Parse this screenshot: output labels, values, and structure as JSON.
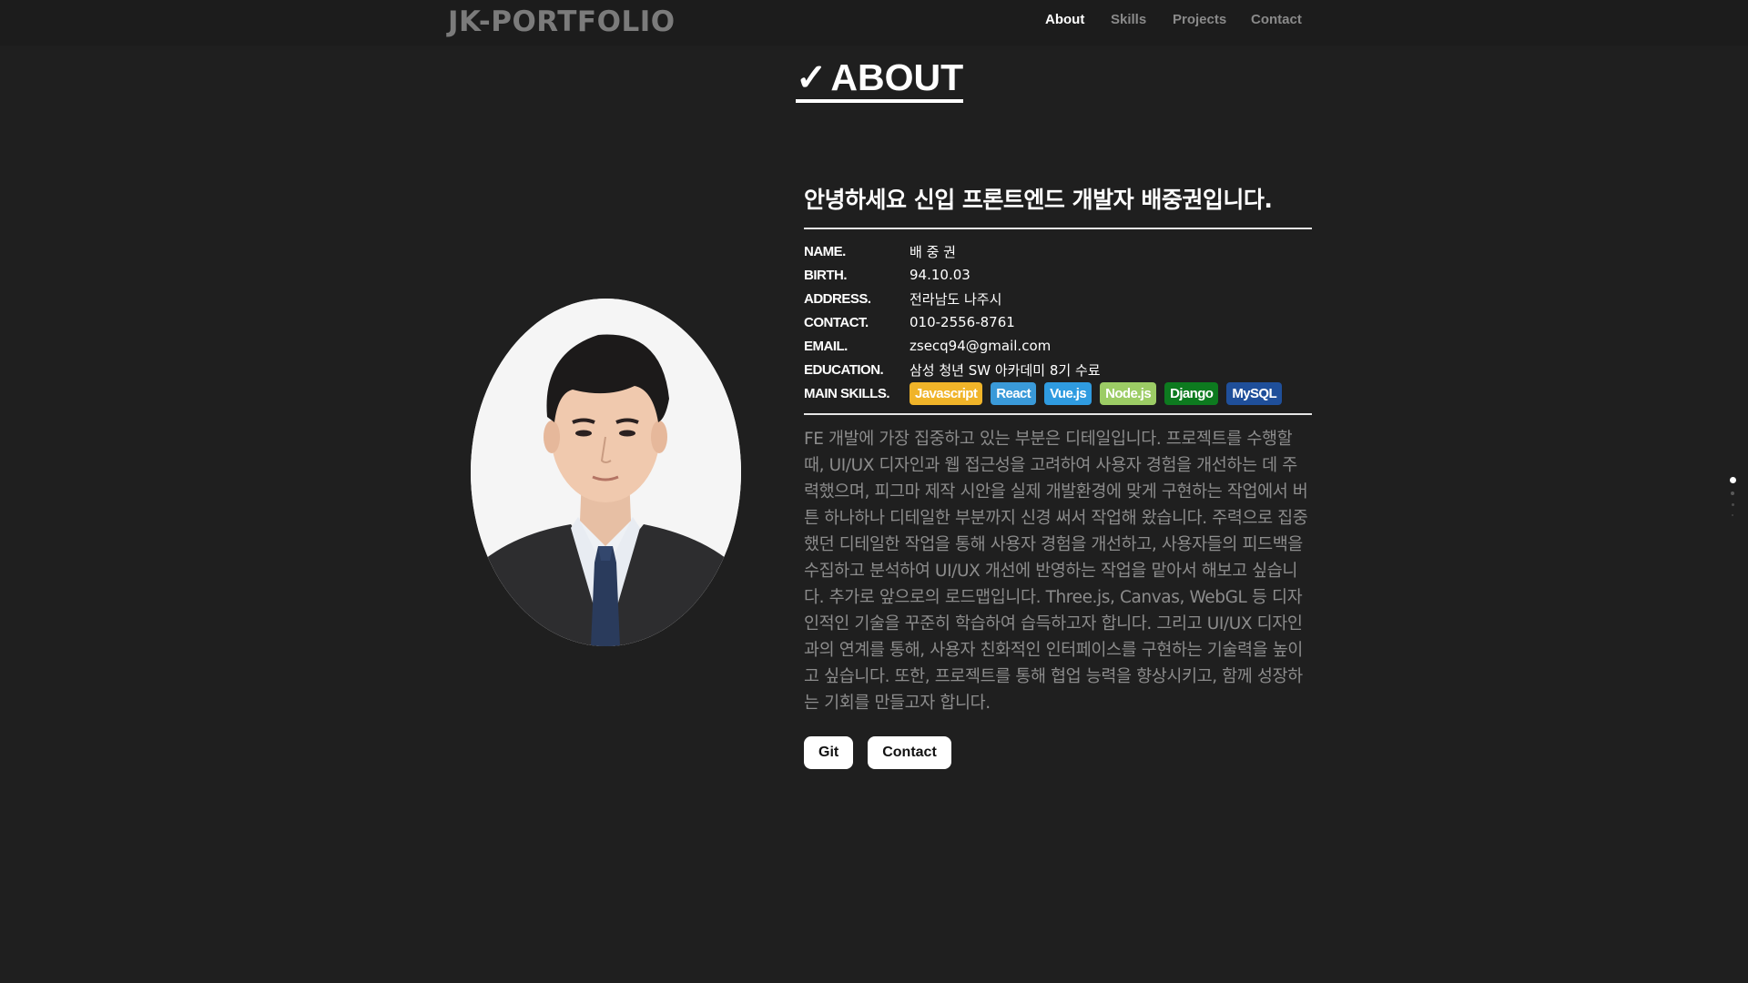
{
  "header": {
    "logo": "JK-PORTFOLIO",
    "nav": [
      {
        "label": "About",
        "active": true
      },
      {
        "label": "Skills",
        "active": false
      },
      {
        "label": "Projects",
        "active": false
      },
      {
        "label": "Contact",
        "active": false
      }
    ]
  },
  "section": {
    "check": "✓",
    "title": "ABOUT"
  },
  "profile": {
    "headline": "안녕하세요 신입 프론트엔드 개발자 배중권입니다.",
    "fields": [
      {
        "key": "NAME.",
        "value": "배 중 권"
      },
      {
        "key": "BIRTH.",
        "value": "94.10.03"
      },
      {
        "key": "ADDRESS.",
        "value": "전라남도 나주시"
      },
      {
        "key": "CONTACT.",
        "value": "010-2556-8761"
      },
      {
        "key": "EMAIL.",
        "value": "zsecq94@gmail.com"
      },
      {
        "key": "EDUCATION.",
        "value": "삼성 청년 SW 아카데미 8기 수료"
      }
    ],
    "skills_label": "MAIN SKILLS.",
    "skills": [
      {
        "name": "Javascript",
        "color": "#f0b429"
      },
      {
        "name": "React",
        "color": "#3a9ad9"
      },
      {
        "name": "Vue.js",
        "color": "#2f9be0"
      },
      {
        "name": "Node.js",
        "color": "#9ccc65"
      },
      {
        "name": "Django",
        "color": "#0d7a1f"
      },
      {
        "name": "MySQL",
        "color": "#1f4f9a"
      }
    ],
    "description": "FE 개발에 가장 집중하고 있는 부분은 디테일입니다. 프로젝트를 수행할 때, UI/UX 디자인과 웹 접근성을 고려하여 사용자 경험을 개선하는 데 주력했으며, 피그마 제작 시안을 실제 개발환경에 맞게 구현하는 작업에서 버튼 하나하나 디테일한 부분까지 신경 써서 작업해 왔습니다. 주력으로 집중했던 디테일한 작업을 통해 사용자 경험을 개선하고, 사용자들의 피드백을 수집하고 분석하여 UI/UX 개선에 반영하는 작업을 맡아서 해보고 싶습니다. 추가로 앞으로의 로드맵입니다. Three.js, Canvas, WebGL 등 디자인적인 기술을 꾸준히 학습하여 습득하고자 합니다. 그리고 UI/UX 디자인과의 연계를 통해, 사용자 친화적인 인터페이스를 구현하는 기술력을 높이고 싶습니다. 또한, 프로젝트를 통해 협업 능력을 향상시키고, 함께 성장하는 기회를 만들고자 합니다.",
    "buttons": {
      "git": "Git",
      "contact": "Contact"
    }
  },
  "colors": {
    "background": "#1f1f1f",
    "accent": "#ffffff",
    "muted": "#8c8c8c"
  }
}
